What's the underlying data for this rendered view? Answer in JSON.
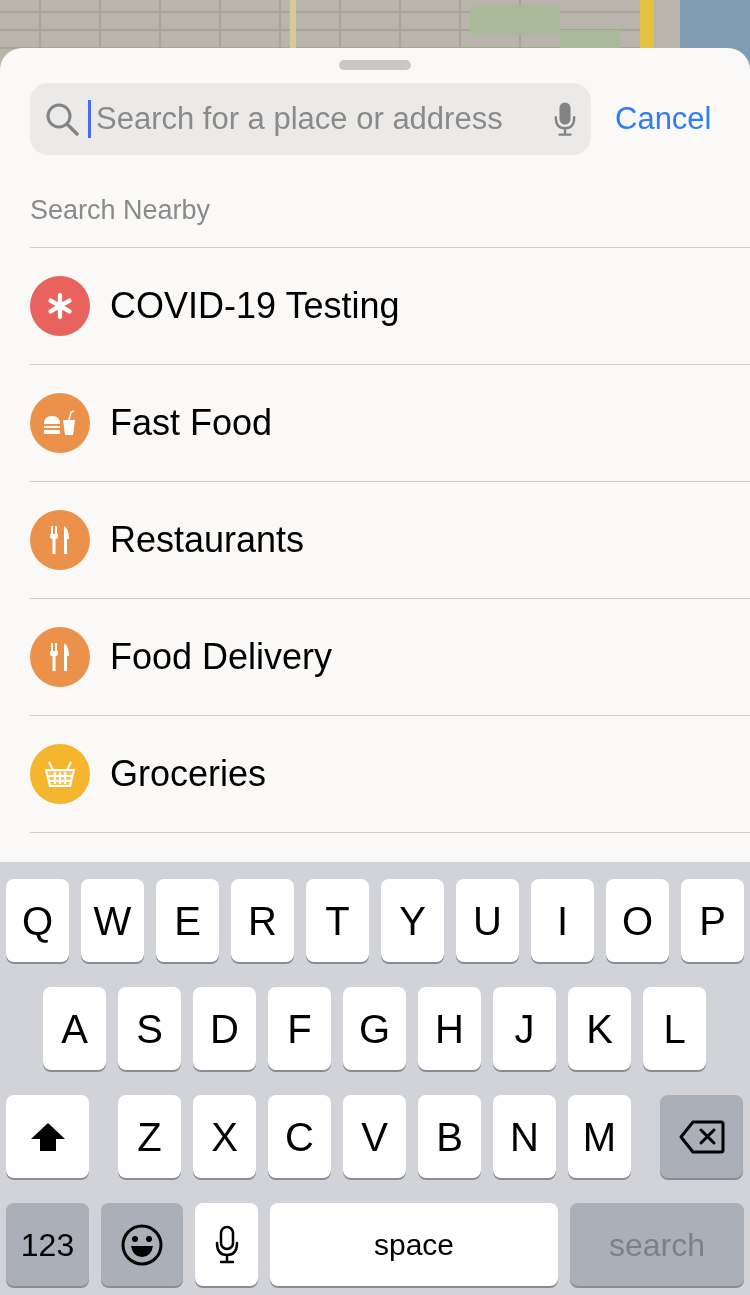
{
  "search": {
    "placeholder": "Search for a place or address",
    "focused": true
  },
  "cancel": "Cancel",
  "section_title": "Search Nearby",
  "categories": [
    {
      "label": "COVID-19 Testing",
      "kind": "asterisk",
      "color": "#e8625e"
    },
    {
      "label": "Fast Food",
      "kind": "fastfood",
      "color": "#eb914a"
    },
    {
      "label": "Restaurants",
      "kind": "utensils",
      "color": "#eb914a"
    },
    {
      "label": "Food Delivery",
      "kind": "utensils",
      "color": "#eb914a"
    },
    {
      "label": "Groceries",
      "kind": "basket",
      "color": "#f3b62e"
    }
  ],
  "keyboard": {
    "letter_rows": [
      [
        {
          "kind": "letter",
          "label": "Q"
        },
        {
          "kind": "letter",
          "label": "W"
        },
        {
          "kind": "letter",
          "label": "E"
        },
        {
          "kind": "letter",
          "label": "R"
        },
        {
          "kind": "letter",
          "label": "T"
        },
        {
          "kind": "letter",
          "label": "Y"
        },
        {
          "kind": "letter",
          "label": "U"
        },
        {
          "kind": "letter",
          "label": "I"
        },
        {
          "kind": "letter",
          "label": "O"
        },
        {
          "kind": "letter",
          "label": "P"
        }
      ],
      [
        {
          "kind": "letter",
          "label": "A"
        },
        {
          "kind": "letter",
          "label": "S"
        },
        {
          "kind": "letter",
          "label": "D"
        },
        {
          "kind": "letter",
          "label": "F"
        },
        {
          "kind": "letter",
          "label": "G"
        },
        {
          "kind": "letter",
          "label": "H"
        },
        {
          "kind": "letter",
          "label": "J"
        },
        {
          "kind": "letter",
          "label": "K"
        },
        {
          "kind": "letter",
          "label": "L"
        }
      ],
      [
        {
          "kind": "shift"
        },
        {
          "kind": "letter",
          "label": "Z"
        },
        {
          "kind": "letter",
          "label": "X"
        },
        {
          "kind": "letter",
          "label": "C"
        },
        {
          "kind": "letter",
          "label": "V"
        },
        {
          "kind": "letter",
          "label": "B"
        },
        {
          "kind": "letter",
          "label": "N"
        },
        {
          "kind": "letter",
          "label": "M"
        },
        {
          "kind": "delete"
        }
      ]
    ],
    "bottom_keys": [
      {
        "kind": "numbers",
        "label": "123"
      },
      {
        "kind": "emoji"
      },
      {
        "kind": "mic"
      },
      {
        "kind": "space",
        "label": "space"
      },
      {
        "kind": "search",
        "label": "search"
      }
    ]
  }
}
